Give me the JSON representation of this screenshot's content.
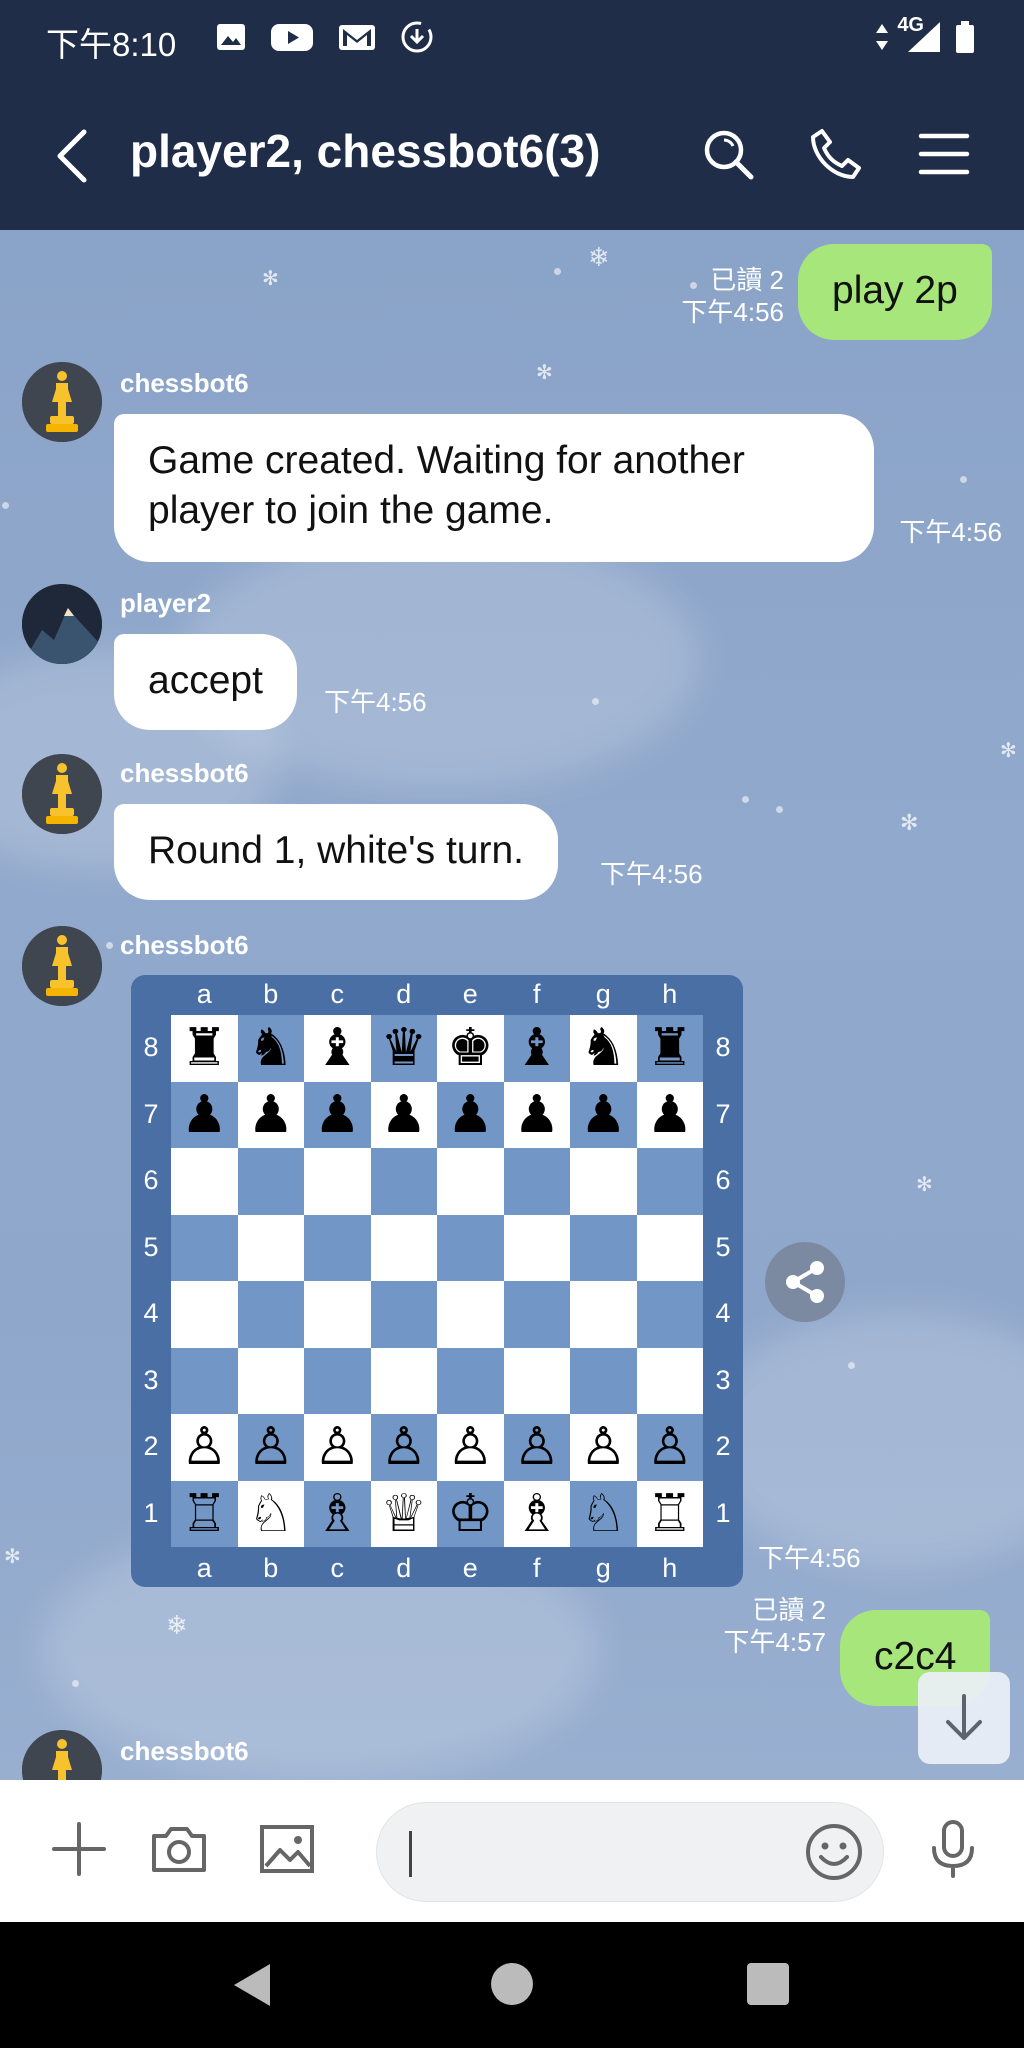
{
  "status_bar": {
    "time": "下午8:10",
    "network": "4G",
    "icons": [
      "gallery-icon",
      "youtube-icon",
      "gmail-icon",
      "download-icon",
      "data-arrows-icon",
      "signal-icon",
      "battery-icon"
    ]
  },
  "header": {
    "title": "player2, chessbot6(3)",
    "icons": [
      "back-icon",
      "search-icon",
      "phone-icon",
      "menu-icon"
    ]
  },
  "messages": [
    {
      "from": "me",
      "text": "play 2p",
      "read": "已讀 2",
      "time": "下午4:56"
    },
    {
      "from": "chessbot6",
      "text": "Game created. Waiting for another player to join the game.",
      "time": "下午4:56"
    },
    {
      "from": "player2",
      "text": "accept",
      "time": "下午4:56"
    },
    {
      "from": "chessbot6",
      "text": "Round 1, white's turn.",
      "time": "下午4:56"
    },
    {
      "from": "chessbot6",
      "type": "board",
      "time": "下午4:56"
    },
    {
      "from": "me",
      "text": "c2c4",
      "read": "已讀 2",
      "time": "下午4:57"
    },
    {
      "from": "chessbot6",
      "text": ""
    }
  ],
  "senders": {
    "bot": "chessbot6",
    "player": "player2"
  },
  "board": {
    "files": [
      "a",
      "b",
      "c",
      "d",
      "e",
      "f",
      "g",
      "h"
    ],
    "ranks": [
      "8",
      "7",
      "6",
      "5",
      "4",
      "3",
      "2",
      "1"
    ],
    "rows": [
      [
        "♜",
        "♞",
        "♝",
        "♛",
        "♚",
        "♝",
        "♞",
        "♜"
      ],
      [
        "♟",
        "♟",
        "♟",
        "♟",
        "♟",
        "♟",
        "♟",
        "♟"
      ],
      [
        "",
        "",
        "",
        "",
        "",
        "",
        "",
        ""
      ],
      [
        "",
        "",
        "",
        "",
        "",
        "",
        "",
        ""
      ],
      [
        "",
        "",
        "",
        "",
        "",
        "",
        "",
        ""
      ],
      [
        "",
        "",
        "",
        "",
        "",
        "",
        "",
        ""
      ],
      [
        "♙",
        "♙",
        "♙",
        "♙",
        "♙",
        "♙",
        "♙",
        "♙"
      ],
      [
        "♖",
        "♘",
        "♗",
        "♕",
        "♔",
        "♗",
        "♘",
        "♖"
      ]
    ]
  },
  "composer": {
    "placeholder": "",
    "icons": [
      "plus-icon",
      "camera-icon",
      "image-icon",
      "emoji-icon",
      "microphone-icon"
    ]
  },
  "colors": {
    "header": "#1f2d48",
    "my_bubble": "#a6e67b",
    "board_dark": "#7296c6",
    "board_frame": "#4a6fa5"
  }
}
